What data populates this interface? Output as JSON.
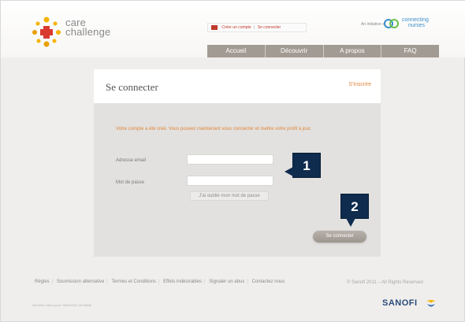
{
  "header": {
    "logo_line1": "care",
    "logo_line2": "challenge",
    "create_account": "Créer un compte",
    "separator": "|",
    "login_link": "Se connecter",
    "initiative_text": "An initiative of",
    "partner_line1": "connecting",
    "partner_line2": "nurses"
  },
  "nav": {
    "items": [
      "Accueil",
      "Découvrir",
      "A propos",
      "FAQ"
    ]
  },
  "login": {
    "title": "Se connecter",
    "signup_link": "S'inscrire",
    "success_message": "Votre compte a été créé. Vous pouvez maintenant vous connecter et mettre votre profil à jour.",
    "email_label": "Adresse email",
    "password_label": "Mot de passe",
    "email_value": "",
    "password_value": "",
    "forgot_password": "J'ai oublié mon mot de passe",
    "submit": "Se connecter"
  },
  "callouts": {
    "one": "1",
    "two": "2"
  },
  "footer": {
    "links": [
      "Règles",
      "Soumission alternative",
      "Termes et Conditions",
      "Effets indésirables",
      "Signaler un abus",
      "Contactez nous"
    ],
    "copyright": "© Sanofi 2011 – All Rights Reserved",
    "updated": "Dernière mise à jour: 06/22/2011 09:46AM",
    "brand": "SANOFI"
  },
  "colors": {
    "accent_orange": "#e0853a",
    "nav_bg": "#a29b93",
    "callout_bg": "#0f2b4d",
    "brand_blue": "#2a4a7a"
  }
}
